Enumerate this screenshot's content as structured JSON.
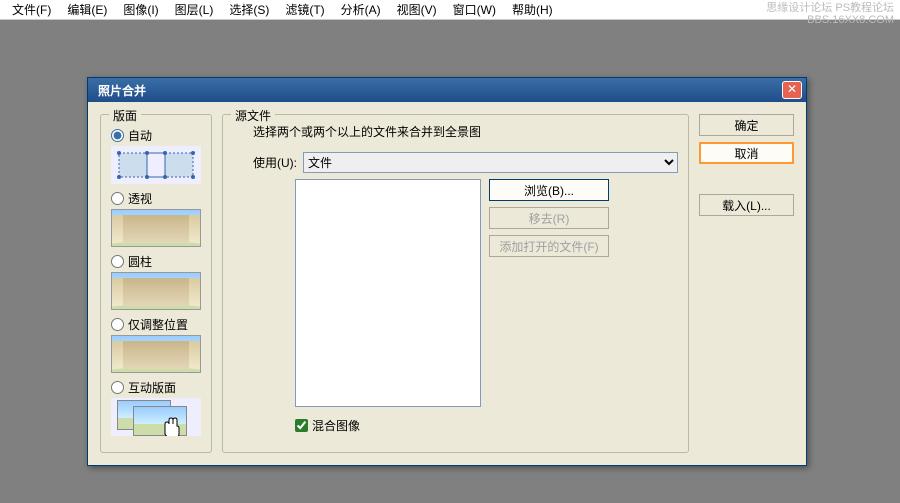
{
  "menu": {
    "file": "文件(F)",
    "edit": "编辑(E)",
    "image": "图像(I)",
    "layer": "图层(L)",
    "select": "选择(S)",
    "filter": "滤镜(T)",
    "analysis": "分析(A)",
    "view": "视图(V)",
    "window": "窗口(W)",
    "help": "帮助(H)"
  },
  "watermark": {
    "line1": "思缘设计论坛  PS教程论坛",
    "line2": "BBS.16XX8.COM"
  },
  "dialog": {
    "title": "照片合并",
    "layout": {
      "legend": "版面",
      "auto": "自动",
      "perspective": "透视",
      "cylinder": "圆柱",
      "reposition": "仅调整位置",
      "interactive": "互动版面"
    },
    "source": {
      "legend": "源文件",
      "desc": "选择两个或两个以上的文件来合并到全景图",
      "use_label": "使用(U):",
      "use_value": "文件",
      "browse": "浏览(B)...",
      "remove": "移去(R)",
      "add_open": "添加打开的文件(F)",
      "blend": "混合图像"
    },
    "actions": {
      "ok": "确定",
      "cancel": "取消",
      "load": "载入(L)..."
    }
  }
}
